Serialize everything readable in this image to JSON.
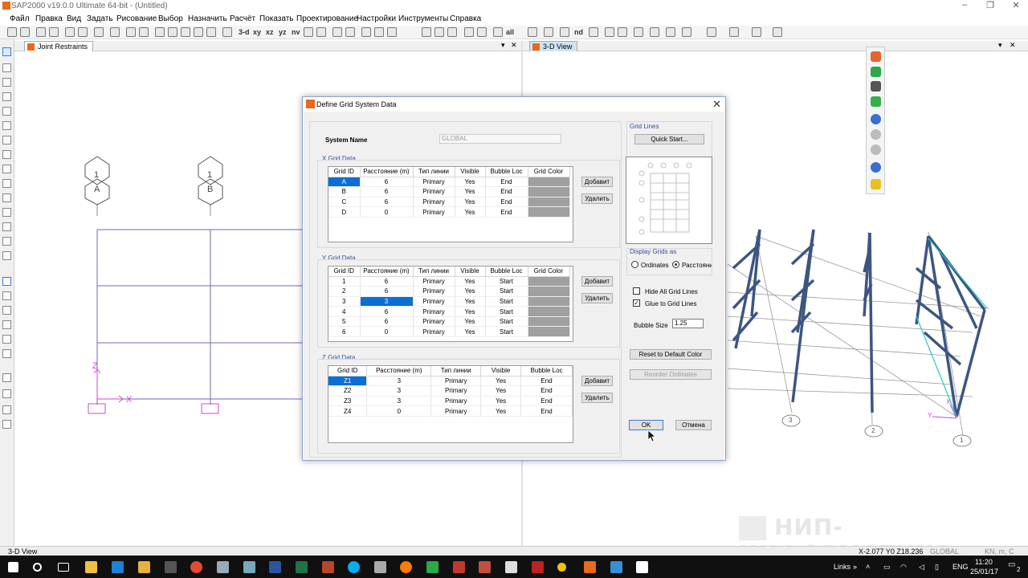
{
  "app": {
    "title": "SAP2000 v19.0.0 Ultimate 64-bit - (Untitled)",
    "menu": [
      "Файл",
      "Правка",
      "Вид",
      "Задать",
      "Рисование",
      "Выбор",
      "Назначить",
      "Расчёт",
      "Показать",
      "Проектирование",
      "Настройки",
      "Инструменты",
      "Справка"
    ]
  },
  "toolbar": {
    "view_3d": "3-d",
    "view_xy": "xy",
    "view_xz": "xz",
    "view_yz": "yz",
    "view_nv": "nv",
    "view_nd": "nd",
    "view_all": "all"
  },
  "left_pane": {
    "tab_title": "Joint Restraints",
    "grid_bubbles_top": [
      "1",
      "1"
    ],
    "grid_bubbles_letters": [
      "A",
      "B"
    ],
    "axis_z": "Z",
    "axis_x": "X"
  },
  "right_pane": {
    "tab_title": "3-D View",
    "bubbles": [
      "3",
      "2",
      "1"
    ],
    "axis_y": "Y",
    "axis_x": "X"
  },
  "dialog": {
    "title": "Define Grid System Data",
    "system_name_label": "System Name",
    "system_name_value": "GLOBAL",
    "x_grid": {
      "label": "X Grid Data",
      "headers": [
        "Grid ID",
        "Расстояние (m)",
        "Тип линии",
        "Visible",
        "Bubble Loc",
        "Grid Color"
      ],
      "rows": [
        [
          "A",
          "6",
          "Primary",
          "Yes",
          "End"
        ],
        [
          "B",
          "6",
          "Primary",
          "Yes",
          "End"
        ],
        [
          "C",
          "6",
          "Primary",
          "Yes",
          "End"
        ],
        [
          "D",
          "0",
          "Primary",
          "Yes",
          "End"
        ]
      ],
      "add": "Добавит",
      "delete": "Удалить"
    },
    "y_grid": {
      "label": "Y Grid Data",
      "headers": [
        "Grid ID",
        "Расстояние (m)",
        "Тип линии",
        "Visible",
        "Bubble Loc",
        "Grid Color"
      ],
      "rows": [
        [
          "1",
          "6",
          "Primary",
          "Yes",
          "Start"
        ],
        [
          "2",
          "6",
          "Primary",
          "Yes",
          "Start"
        ],
        [
          "3",
          "3",
          "Primary",
          "Yes",
          "Start"
        ],
        [
          "4",
          "6",
          "Primary",
          "Yes",
          "Start"
        ],
        [
          "5",
          "6",
          "Primary",
          "Yes",
          "Start"
        ],
        [
          "6",
          "0",
          "Primary",
          "Yes",
          "Start"
        ]
      ],
      "add": "Добавит",
      "delete": "Удалить"
    },
    "z_grid": {
      "label": "Z Grid Data",
      "headers": [
        "Grid ID",
        "Расстояние (m)",
        "Тип линии",
        "Visible",
        "Bubble Loc"
      ],
      "rows": [
        [
          "Z1",
          "3",
          "Primary",
          "Yes",
          "End"
        ],
        [
          "Z2",
          "3",
          "Primary",
          "Yes",
          "End"
        ],
        [
          "Z3",
          "3",
          "Primary",
          "Yes",
          "End"
        ],
        [
          "Z4",
          "0",
          "Primary",
          "Yes",
          "End"
        ]
      ],
      "add": "Добавит",
      "delete": "Удалить"
    },
    "grid_lines_label": "Grid Lines",
    "quick_start": "Quick Start...",
    "display_as_label": "Display Grids as",
    "opt_ordinates": "Ordinates",
    "opt_spacing": "Расстояния",
    "hide_all": "Hide All Grid Lines",
    "hide_all_checked": false,
    "glue": "Glue to Grid Lines",
    "glue_checked": true,
    "bubble_size_label": "Bubble Size",
    "bubble_size_value": "1.25",
    "reset_color": "Reset to Default Color",
    "reorder": "Reorder Ordinates",
    "ok": "OK",
    "cancel": "Отмена",
    "checkmark": "✓"
  },
  "statusbar": {
    "left": "3-D View",
    "coords": "X-2.077  Y0  Z18.236",
    "system": "GLOBAL",
    "units": "KN, m, C"
  },
  "taskbar": {
    "links": "Links",
    "lang": "ENG",
    "time": "11:20",
    "date": "25/01/17",
    "notifications": "2"
  },
  "watermark": "НИП-ИНФОРМАТИКА",
  "colors": {
    "selection": "#0a6fd6",
    "grid_color_cell": "#a0a0a0",
    "group_label": "#2b4f9e",
    "frame": "#3d5580",
    "grid_lines_2d": "#6a6ab8"
  }
}
